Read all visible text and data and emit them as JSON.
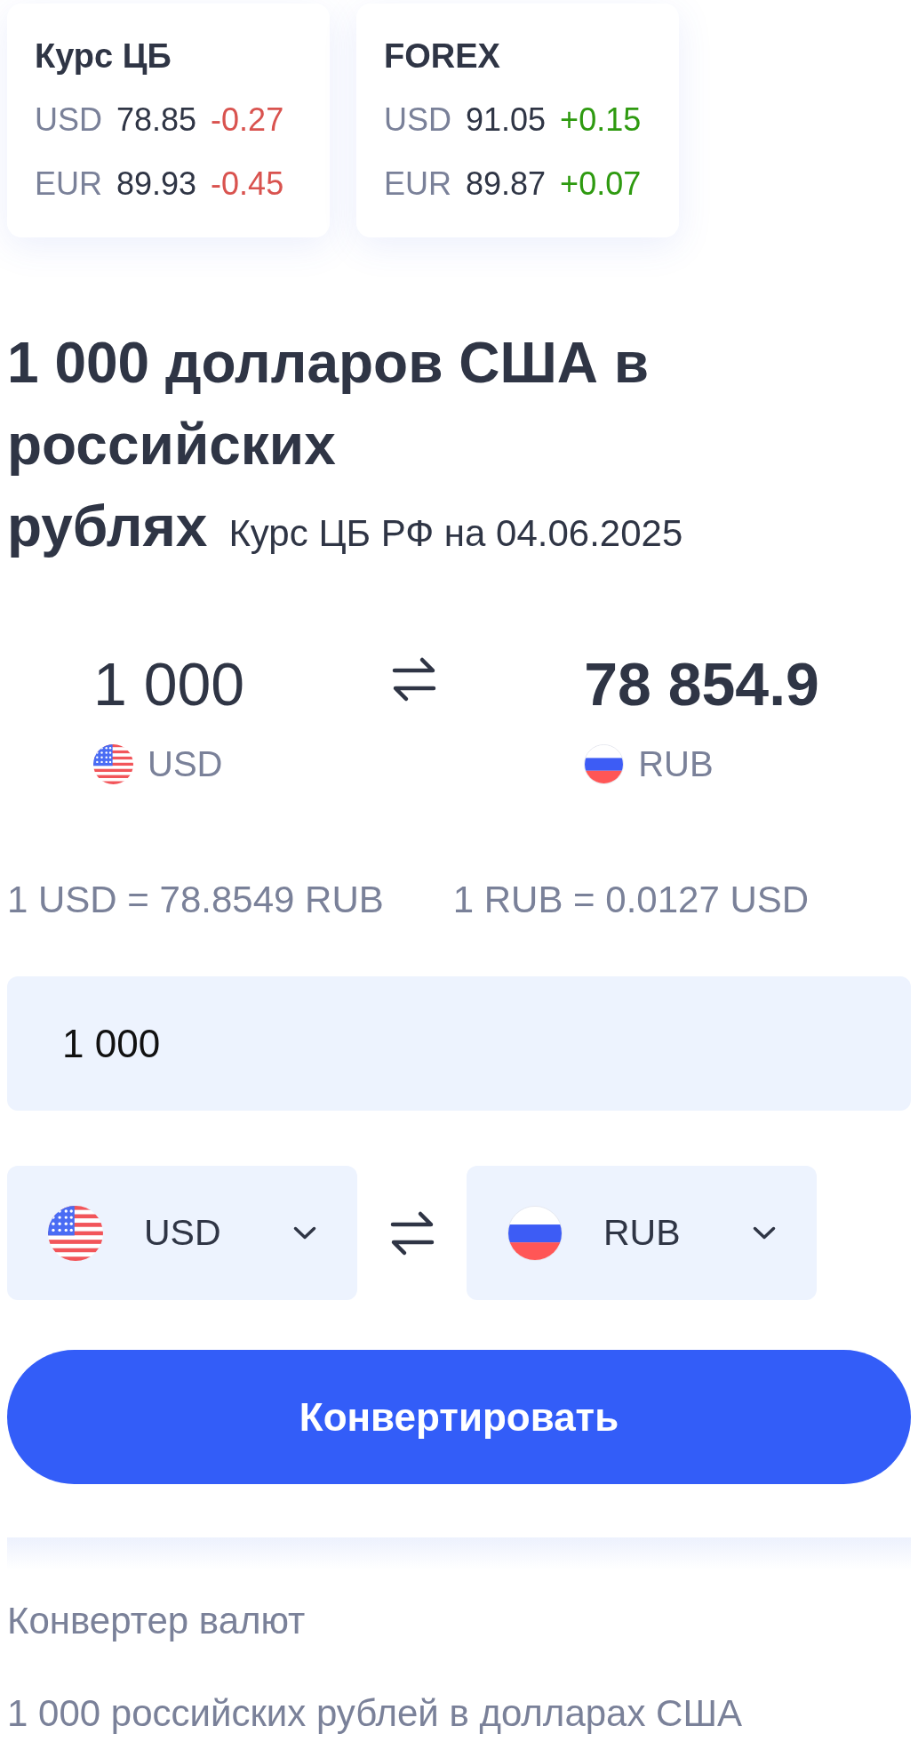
{
  "rate_cards": [
    {
      "title": "Курс ЦБ",
      "rows": [
        {
          "currency": "USD",
          "rate": "78.85",
          "change": "-0.27",
          "color": "#d9534f"
        },
        {
          "currency": "EUR",
          "rate": "89.93",
          "change": "-0.45",
          "color": "#d9534f"
        }
      ]
    },
    {
      "title": "FOREX",
      "rows": [
        {
          "currency": "USD",
          "rate": "91.05",
          "change": "+0.15",
          "color": "#2e9a10"
        },
        {
          "currency": "EUR",
          "rate": "89.87",
          "change": "+0.07",
          "color": "#2e9a10"
        }
      ]
    }
  ],
  "heading": {
    "title": "1 000 долларов США в российских рублях",
    "subtitle": "Курс ЦБ РФ на 04.06.2025"
  },
  "result": {
    "from": {
      "amount": "1 000",
      "currency": "USD",
      "kind": "us"
    },
    "to": {
      "amount": "78 854.9",
      "currency": "RUB",
      "kind": "ru"
    }
  },
  "rates": [
    "1 USD = 78.8549 RUB",
    "1 RUB = 0.0127 USD"
  ],
  "amount_field": {
    "value": "1 000"
  },
  "selects": [
    {
      "currency": "USD",
      "kind": "us"
    },
    {
      "currency": "RUB",
      "kind": "ru"
    }
  ],
  "convert_button": {
    "label": "Конвертировать"
  },
  "links": [
    "Конвертер валют",
    "1 000 российских рублей в долларах США"
  ]
}
